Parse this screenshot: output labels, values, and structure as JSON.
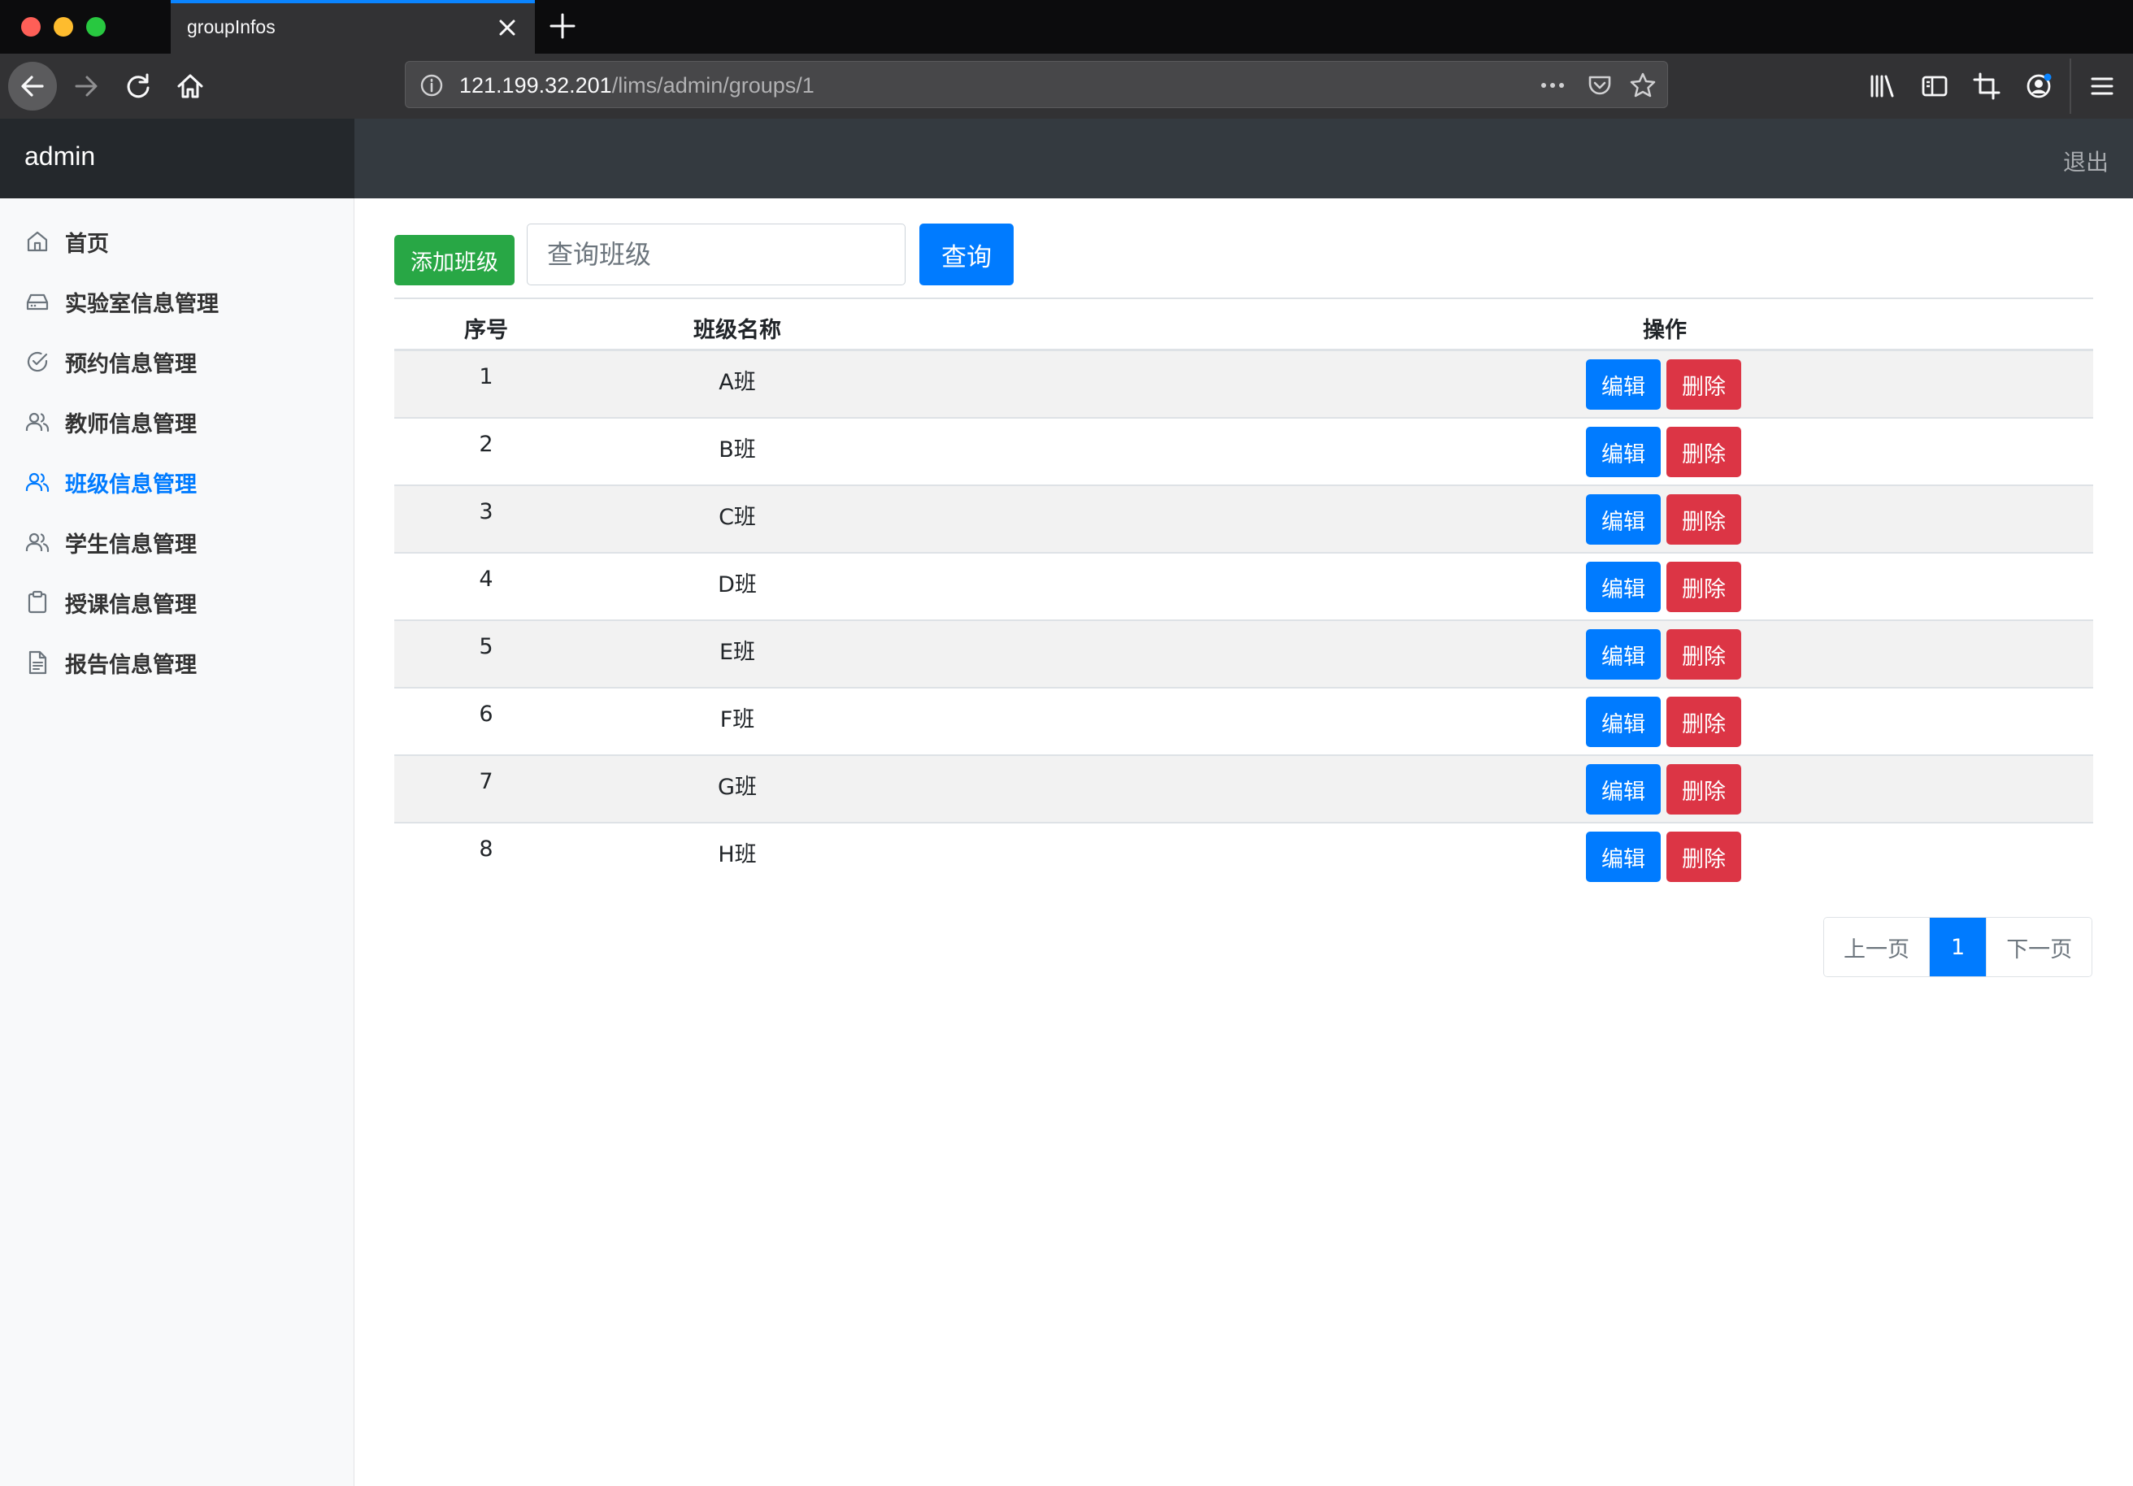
{
  "browser": {
    "tab_title": "groupInfos",
    "url_host": "121.199.32.201",
    "url_path": "/lims/admin/groups/1"
  },
  "app": {
    "brand": "admin",
    "logout": "退出"
  },
  "sidebar": {
    "items": [
      {
        "label": "首页",
        "icon": "home-icon"
      },
      {
        "label": "实验室信息管理",
        "icon": "hard-drive-icon"
      },
      {
        "label": "预约信息管理",
        "icon": "check-circle-icon"
      },
      {
        "label": "教师信息管理",
        "icon": "users-icon"
      },
      {
        "label": "班级信息管理",
        "icon": "users-icon",
        "active": true
      },
      {
        "label": "学生信息管理",
        "icon": "users-icon"
      },
      {
        "label": "授课信息管理",
        "icon": "clipboard-icon"
      },
      {
        "label": "报告信息管理",
        "icon": "file-text-icon"
      }
    ]
  },
  "toolbar": {
    "add_label": "添加班级",
    "search_placeholder": "查询班级",
    "query_label": "查询"
  },
  "table": {
    "headers": [
      "序号",
      "班级名称",
      "操作"
    ],
    "rows": [
      {
        "index": "1",
        "name": "A班"
      },
      {
        "index": "2",
        "name": "B班"
      },
      {
        "index": "3",
        "name": "C班"
      },
      {
        "index": "4",
        "name": "D班"
      },
      {
        "index": "5",
        "name": "E班"
      },
      {
        "index": "6",
        "name": "F班"
      },
      {
        "index": "7",
        "name": "G班"
      },
      {
        "index": "8",
        "name": "H班"
      }
    ],
    "edit_label": "编辑",
    "delete_label": "删除"
  },
  "pagination": {
    "prev": "上一页",
    "current": "1",
    "next": "下一页"
  },
  "colors": {
    "primary": "#007bff",
    "success": "#28a745",
    "danger": "#dc3545",
    "topbar": "#343a40"
  }
}
